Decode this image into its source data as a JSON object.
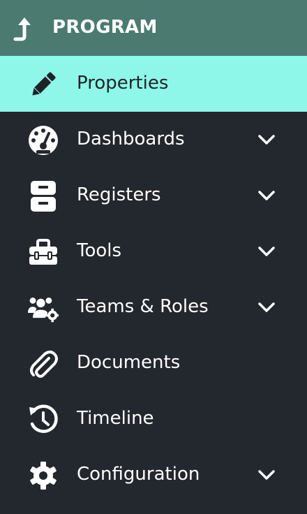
{
  "header": {
    "title": "PROGRAM",
    "icon": "arrow-up-turn-icon",
    "background": "#4a7a70"
  },
  "colors": {
    "sidebar_bg": "#23272e",
    "active_bg": "#8ef7e9",
    "text": "#ffffff",
    "active_text": "#1f2328"
  },
  "nav": {
    "items": [
      {
        "label": "Properties",
        "icon": "pencil-icon",
        "active": true,
        "expandable": false
      },
      {
        "label": "Dashboards",
        "icon": "dashboard-gauge-icon",
        "active": false,
        "expandable": true
      },
      {
        "label": "Registers",
        "icon": "file-cabinet-icon",
        "active": false,
        "expandable": true
      },
      {
        "label": "Tools",
        "icon": "toolbox-icon",
        "active": false,
        "expandable": true
      },
      {
        "label": "Teams & Roles",
        "icon": "users-cog-icon",
        "active": false,
        "expandable": true
      },
      {
        "label": "Documents",
        "icon": "paperclip-icon",
        "active": false,
        "expandable": false
      },
      {
        "label": "Timeline",
        "icon": "history-icon",
        "active": false,
        "expandable": false
      },
      {
        "label": "Configuration",
        "icon": "gear-icon",
        "active": false,
        "expandable": true
      }
    ]
  }
}
